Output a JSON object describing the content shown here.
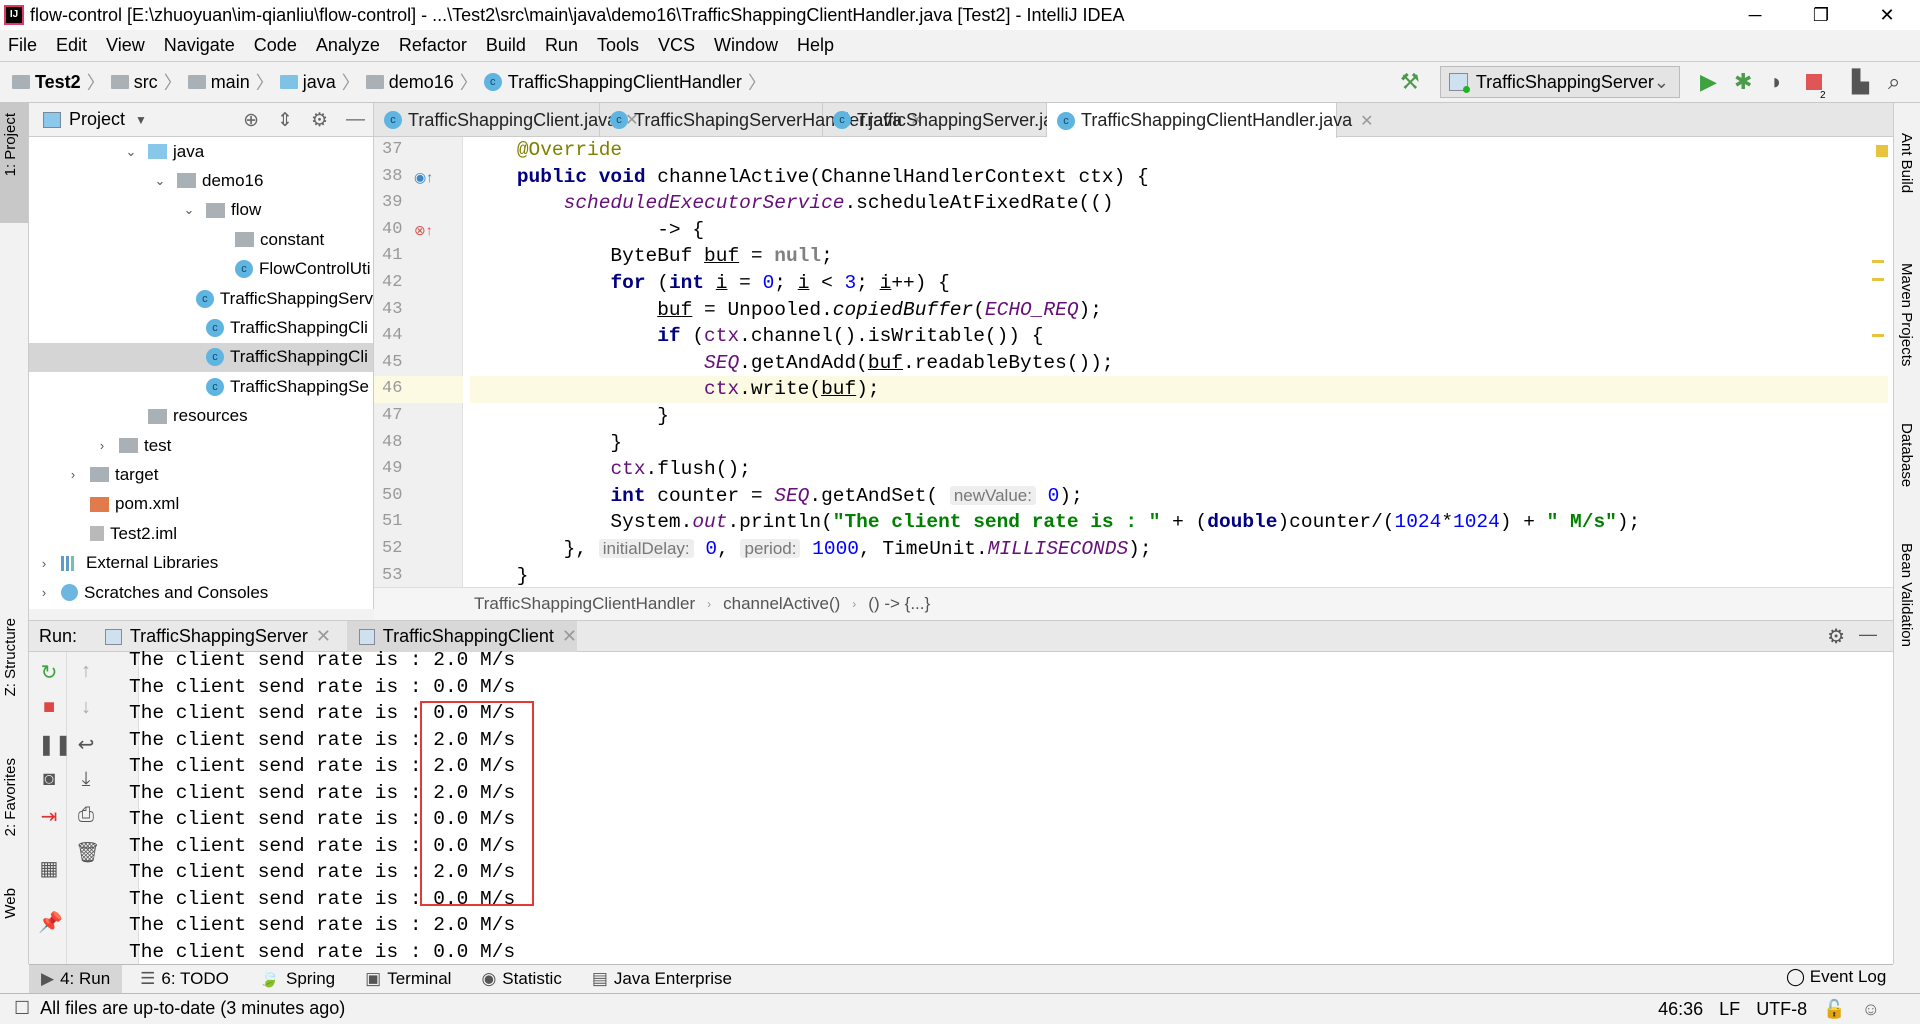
{
  "window": {
    "title": "flow-control [E:\\zhuoyuan\\im-qianliu\\flow-control] - ...\\Test2\\src\\main\\java\\demo16\\TrafficShappingClientHandler.java [Test2] - IntelliJ IDEA",
    "minimize": "─",
    "maximize": "❐",
    "close": "✕"
  },
  "menu": [
    "File",
    "Edit",
    "View",
    "Navigate",
    "Code",
    "Analyze",
    "Refactor",
    "Build",
    "Run",
    "Tools",
    "VCS",
    "Window",
    "Help"
  ],
  "breadcrumb": [
    "Test2",
    "src",
    "main",
    "java",
    "demo16",
    "TrafficShappingClientHandler"
  ],
  "run_config": {
    "selected": "TrafficShappingServer",
    "stop_badge": "2"
  },
  "left_strip": {
    "project": "1: Project",
    "structure": "Z: Structure",
    "favorites": "2: Favorites",
    "web": "Web"
  },
  "right_strip": {
    "ant": "Ant Build",
    "maven": "Maven Projects",
    "database": "Database",
    "bean": "Bean Validation"
  },
  "project": {
    "title": "Project",
    "items": [
      {
        "label": "java",
        "depth": 3,
        "arrow": "⌄",
        "icon": "folder-blue"
      },
      {
        "label": "demo16",
        "depth": 4,
        "arrow": "⌄",
        "icon": "package"
      },
      {
        "label": "flow",
        "depth": 5,
        "arrow": "⌄",
        "icon": "package"
      },
      {
        "label": "constant",
        "depth": 6,
        "arrow": "",
        "icon": "package"
      },
      {
        "label": "FlowControlUti",
        "depth": 6,
        "arrow": "",
        "icon": "class"
      },
      {
        "label": "TrafficShappingServ",
        "depth": 5,
        "arrow": "",
        "icon": "class"
      },
      {
        "label": "TrafficShappingCli",
        "depth": 5,
        "arrow": "",
        "icon": "class-run"
      },
      {
        "label": "TrafficShappingCli",
        "depth": 5,
        "arrow": "",
        "icon": "class",
        "selected": true
      },
      {
        "label": "TrafficShappingSe",
        "depth": 5,
        "arrow": "",
        "icon": "class-run"
      },
      {
        "label": "resources",
        "depth": 3,
        "arrow": "",
        "icon": "folder"
      },
      {
        "label": "test",
        "depth": 2,
        "arrow": "›",
        "icon": "folder"
      },
      {
        "label": "target",
        "depth": 1,
        "arrow": "›",
        "icon": "folder"
      },
      {
        "label": "pom.xml",
        "depth": 1,
        "arrow": "",
        "icon": "xml"
      },
      {
        "label": "Test2.iml",
        "depth": 1,
        "arrow": "",
        "icon": "iml"
      },
      {
        "label": "External Libraries",
        "depth": 0,
        "arrow": "›",
        "icon": "lib"
      },
      {
        "label": "Scratches and Consoles",
        "depth": 0,
        "arrow": "›",
        "icon": "scratch"
      }
    ]
  },
  "editor": {
    "tabs": [
      {
        "label": "TrafficShappingClient.java",
        "active": false
      },
      {
        "label": "TrafficShapingServerHandler.java",
        "active": false
      },
      {
        "label": "TrafficShappingServer.java",
        "active": false
      },
      {
        "label": "TrafficShappingClientHandler.java",
        "active": true
      }
    ],
    "current_line": 46,
    "lines": [
      {
        "n": "37",
        "t": [
          [
            "    "
          ],
          [
            "@Override",
            "an"
          ]
        ]
      },
      {
        "n": "38",
        "t": [
          [
            "    "
          ],
          [
            "public void ",
            "kw"
          ],
          [
            "channelActive(ChannelHandlerContext ctx) {"
          ]
        ]
      },
      {
        "n": "39",
        "t": [
          [
            "        "
          ],
          [
            "scheduledExecutorService",
            "fld"
          ],
          [
            ".scheduleAtFixedRate(()"
          ]
        ]
      },
      {
        "n": "40",
        "t": [
          [
            "                -> {"
          ]
        ]
      },
      {
        "n": "41",
        "t": [
          [
            "            ByteBuf "
          ],
          [
            "buf",
            "u"
          ],
          [
            " = "
          ],
          [
            "null",
            "nul"
          ],
          [
            ";"
          ]
        ]
      },
      {
        "n": "42",
        "t": [
          [
            "            "
          ],
          [
            "for ",
            "kw"
          ],
          [
            "("
          ],
          [
            "int ",
            "kw"
          ],
          [
            "i",
            "u"
          ],
          [
            " = "
          ],
          [
            "0",
            "num"
          ],
          [
            "; "
          ],
          [
            "i",
            "u"
          ],
          [
            " < "
          ],
          [
            "3",
            "num"
          ],
          [
            "; "
          ],
          [
            "i",
            "u"
          ],
          [
            "++) {"
          ]
        ]
      },
      {
        "n": "43",
        "t": [
          [
            "                "
          ],
          [
            "buf",
            "u"
          ],
          [
            " = Unpooled."
          ],
          [
            "copiedBuffer",
            "it"
          ],
          [
            "("
          ],
          [
            "ECHO_REQ",
            "fld"
          ],
          [
            ");"
          ]
        ]
      },
      {
        "n": "44",
        "t": [
          [
            "                "
          ],
          [
            "if ",
            "kw"
          ],
          [
            "("
          ],
          [
            "ctx",
            "par"
          ],
          [
            ".channel().isWritable()) {"
          ]
        ]
      },
      {
        "n": "45",
        "t": [
          [
            "                    "
          ],
          [
            "SEQ",
            "fld"
          ],
          [
            ".getAndAdd("
          ],
          [
            "buf",
            "u"
          ],
          [
            ".readableBytes());"
          ]
        ]
      },
      {
        "n": "46",
        "t": [
          [
            "                    "
          ],
          [
            "ctx",
            "par"
          ],
          [
            ".write("
          ],
          [
            "buf",
            "u"
          ],
          [
            ");"
          ]
        ]
      },
      {
        "n": "47",
        "t": [
          [
            "                }"
          ]
        ]
      },
      {
        "n": "48",
        "t": [
          [
            "            }"
          ]
        ]
      },
      {
        "n": "49",
        "t": [
          [
            "            "
          ],
          [
            "ctx",
            "par"
          ],
          [
            ".flush();"
          ]
        ]
      },
      {
        "n": "50",
        "t": [
          [
            "            "
          ],
          [
            "int ",
            "kw"
          ],
          [
            "counter = "
          ],
          [
            "SEQ",
            "fld"
          ],
          [
            ".getAndSet( "
          ],
          [
            "newValue:",
            "hint"
          ],
          [
            " "
          ],
          [
            "0",
            "num"
          ],
          [
            ");"
          ]
        ]
      },
      {
        "n": "51",
        "t": [
          [
            "            System."
          ],
          [
            "out",
            "fld"
          ],
          [
            ".println("
          ],
          [
            "\"The client send rate is : \"",
            "st"
          ],
          [
            " + ("
          ],
          [
            "double",
            "kw"
          ],
          [
            ")counter/("
          ],
          [
            "1024",
            "num"
          ],
          [
            "*"
          ],
          [
            "1024",
            "num"
          ],
          [
            ") + "
          ],
          [
            "\" M/s\"",
            "st"
          ],
          [
            ");"
          ]
        ]
      },
      {
        "n": "52",
        "t": [
          [
            "        }, "
          ],
          [
            "initialDelay:",
            "hint"
          ],
          [
            " "
          ],
          [
            "0",
            "num"
          ],
          [
            ", "
          ],
          [
            "period:",
            "hint"
          ],
          [
            " "
          ],
          [
            "1000",
            "num"
          ],
          [
            ", TimeUnit."
          ],
          [
            "MILLISECONDS",
            "fld"
          ],
          [
            ");"
          ]
        ]
      },
      {
        "n": "53",
        "t": [
          [
            "    }"
          ]
        ]
      }
    ],
    "breadcrumb": [
      "TrafficShappingClientHandler",
      "channelActive()",
      "() -> {...}"
    ]
  },
  "run": {
    "label": "Run:",
    "tabs": [
      {
        "label": "TrafficShappingServer",
        "active": false
      },
      {
        "label": "TrafficShappingClient",
        "active": true
      }
    ],
    "output": [
      "The client send rate is : 2.0 M/s",
      "The client send rate is : 0.0 M/s",
      "The client send rate is : 0.0 M/s",
      "The client send rate is : 2.0 M/s",
      "The client send rate is : 2.0 M/s",
      "The client send rate is : 2.0 M/s",
      "The client send rate is : 0.0 M/s",
      "The client send rate is : 0.0 M/s",
      "The client send rate is : 2.0 M/s",
      "The client send rate is : 0.0 M/s",
      "The client send rate is : 2.0 M/s",
      "The client send rate is : 0.0 M/s"
    ],
    "highlight_color": "#e53935"
  },
  "bottom_tools": [
    {
      "label": "4: Run",
      "icon": "▶",
      "active": true
    },
    {
      "label": "6: TODO",
      "icon": "☰"
    },
    {
      "label": "Spring",
      "icon": "🍃"
    },
    {
      "label": "Terminal",
      "icon": "▣"
    },
    {
      "label": "Statistic",
      "icon": "◉"
    },
    {
      "label": "Java Enterprise",
      "icon": "▤"
    }
  ],
  "event_log": "Event Log",
  "status": {
    "message": "All files are up-to-date (3 minutes ago)",
    "position": "46:36",
    "line_sep": "LF",
    "encoding": "UTF-8"
  }
}
